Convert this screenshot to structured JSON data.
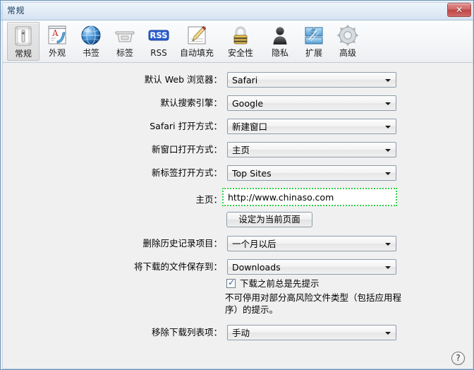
{
  "window": {
    "title": "常规",
    "close_label": "✕"
  },
  "toolbar": {
    "items": [
      {
        "label": "常规",
        "icon": "general-icon",
        "selected": true
      },
      {
        "label": "外观",
        "icon": "appearance-icon",
        "selected": false
      },
      {
        "label": "书签",
        "icon": "bookmarks-globe-icon",
        "selected": false
      },
      {
        "label": "标签",
        "icon": "tabs-icon",
        "selected": false
      },
      {
        "label": "RSS",
        "icon": "rss-icon",
        "selected": false
      },
      {
        "label": "自动填充",
        "icon": "autofill-icon",
        "selected": false
      },
      {
        "label": "安全性",
        "icon": "security-lock-icon",
        "selected": false
      },
      {
        "label": "隐私",
        "icon": "privacy-person-icon",
        "selected": false
      },
      {
        "label": "扩展",
        "icon": "extensions-puzzle-icon",
        "selected": false
      },
      {
        "label": "高级",
        "icon": "advanced-gear-icon",
        "selected": false
      }
    ]
  },
  "form": {
    "default_browser": {
      "label": "默认 Web 浏览器：",
      "value": "Safari"
    },
    "default_search": {
      "label": "默认搜索引擎：",
      "value": "Google"
    },
    "safari_opens_with": {
      "label": "Safari 打开方式：",
      "value": "新建窗口"
    },
    "new_window_opens": {
      "label": "新窗口打开方式：",
      "value": "主页"
    },
    "new_tab_opens": {
      "label": "新标签打开方式：",
      "value": "Top Sites"
    },
    "homepage": {
      "label": "主页：",
      "value": "http://www.chinaso.com",
      "placeholder": ""
    },
    "set_current_page": {
      "label": "设定为当前页面"
    },
    "remove_history": {
      "label": "删除历史记录项目：",
      "value": "一个月以后"
    },
    "save_downloads_to": {
      "label": "将下载的文件保存到：",
      "value": "Downloads"
    },
    "always_prompt": {
      "label": "下载之前总是先提示",
      "checked": true,
      "tick": "✓"
    },
    "download_note": "不可停用对部分高风险文件类型（包括应用程序）的提示。",
    "remove_download_items": {
      "label": "移除下载列表项：",
      "value": "手动"
    }
  },
  "footer": {
    "help_label": "?"
  },
  "colors": {
    "focus_green": "#2fcf4a",
    "close_red": "#bf4545",
    "title_blue": "#14395c",
    "rss_blue": "#2b5fd1"
  }
}
